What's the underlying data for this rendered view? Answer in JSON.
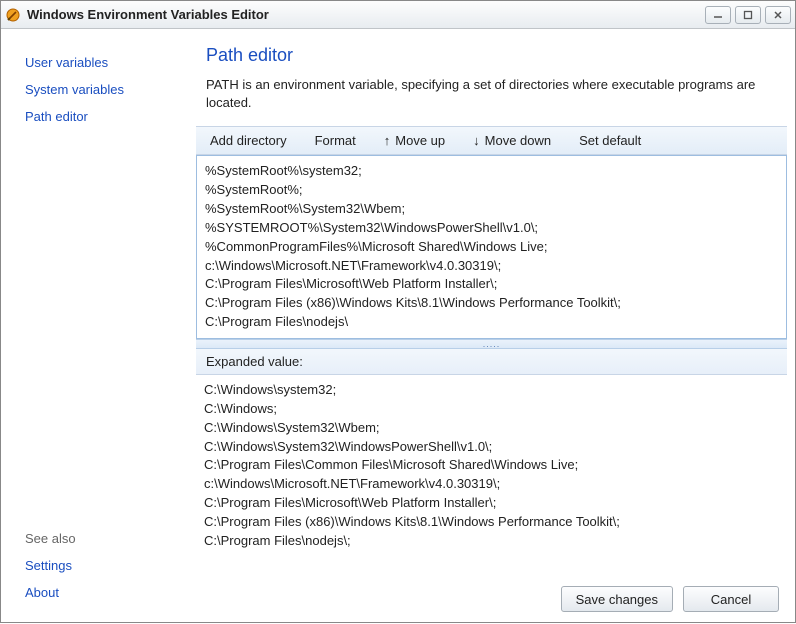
{
  "window": {
    "title": "Windows Environment Variables Editor",
    "min": "−",
    "max": "▢",
    "close": "✕"
  },
  "sidebar": {
    "items": [
      {
        "label": "User variables"
      },
      {
        "label": "System variables"
      },
      {
        "label": "Path editor"
      }
    ],
    "see_also_label": "See also",
    "settings_label": "Settings",
    "about_label": "About"
  },
  "main": {
    "title": "Path editor",
    "description": "PATH is an environment variable, specifying a set of directories where executable programs are located."
  },
  "toolbar": {
    "add_directory": "Add directory",
    "format": "Format",
    "move_up": "Move up",
    "move_down": "Move down",
    "set_default": "Set default"
  },
  "path_entries": [
    "%SystemRoot%\\system32;",
    "%SystemRoot%;",
    "%SystemRoot%\\System32\\Wbem;",
    "%SYSTEMROOT%\\System32\\WindowsPowerShell\\v1.0\\;",
    "%CommonProgramFiles%\\Microsoft Shared\\Windows Live;",
    "c:\\Windows\\Microsoft.NET\\Framework\\v4.0.30319\\;",
    "C:\\Program Files\\Microsoft\\Web Platform Installer\\;",
    "C:\\Program Files (x86)\\Windows Kits\\8.1\\Windows Performance Toolkit\\;",
    "C:\\Program Files\\nodejs\\"
  ],
  "expanded": {
    "label": "Expanded value:",
    "entries": [
      "C:\\Windows\\system32;",
      "C:\\Windows;",
      "C:\\Windows\\System32\\Wbem;",
      "C:\\Windows\\System32\\WindowsPowerShell\\v1.0\\;",
      "C:\\Program Files\\Common Files\\Microsoft Shared\\Windows Live;",
      "c:\\Windows\\Microsoft.NET\\Framework\\v4.0.30319\\;",
      "C:\\Program Files\\Microsoft\\Web Platform Installer\\;",
      "C:\\Program Files (x86)\\Windows Kits\\8.1\\Windows Performance Toolkit\\;",
      "C:\\Program Files\\nodejs\\;"
    ]
  },
  "footer": {
    "save": "Save changes",
    "cancel": "Cancel"
  },
  "splitter_dots": "....."
}
